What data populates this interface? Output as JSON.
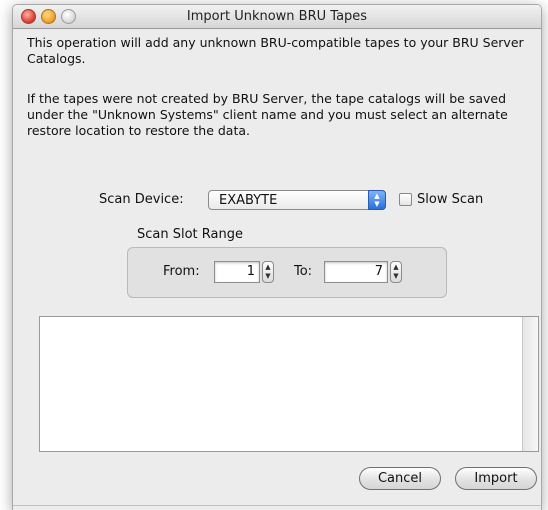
{
  "window": {
    "title": "Import Unknown BRU Tapes"
  },
  "description": {
    "paragraph1": "This operation will add any unknown BRU-compatible tapes to your BRU Server Catalogs.",
    "paragraph2": "If the tapes were not created by BRU Server, the tape catalogs will be saved under the \"Unknown Systems\" client name and you must select an alternate restore location to restore the data."
  },
  "scan_device": {
    "label": "Scan Device:",
    "selected": "EXABYTE",
    "slow_scan_label": "Slow Scan",
    "slow_scan_checked": false
  },
  "slot_range": {
    "title": "Scan Slot Range",
    "from_label": "From:",
    "from_value": "1",
    "to_label": "To:",
    "to_value": "7"
  },
  "buttons": {
    "cancel": "Cancel",
    "import": "Import"
  },
  "colors": {
    "accent": "#2a6fde",
    "window_bg": "#ececec"
  }
}
